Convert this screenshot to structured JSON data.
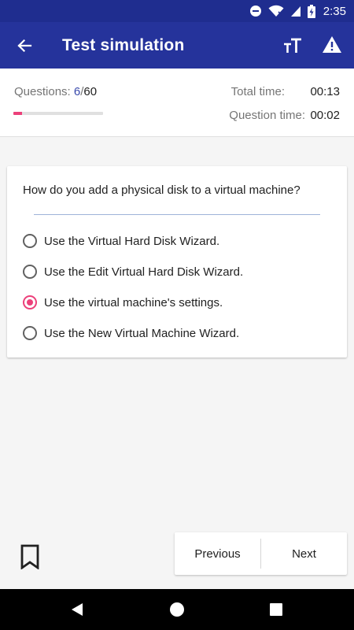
{
  "status_bar": {
    "time": "2:35",
    "icons": [
      "do-not-disturb-icon",
      "wifi-icon",
      "signal-icon",
      "battery-charging-icon"
    ]
  },
  "app_bar": {
    "title": "Test simulation",
    "icons": [
      "back-arrow-icon",
      "text-size-icon",
      "warning-icon"
    ]
  },
  "progress": {
    "questions_label": "Questions:",
    "current": "6",
    "separator": "/",
    "total": "60",
    "fraction": 0.1,
    "fill_color": "#ec407a",
    "total_time_label": "Total time:",
    "total_time": "00:13",
    "question_time_label": "Question time:",
    "question_time": "00:02"
  },
  "question": {
    "text": "How do you add a physical disk to a virtual machine?",
    "answers": [
      {
        "label": "Use the Virtual Hard Disk Wizard.",
        "selected": false
      },
      {
        "label": "Use the Edit Virtual Hard Disk Wizard.",
        "selected": false
      },
      {
        "label": "Use the virtual machine's settings.",
        "selected": true
      },
      {
        "label": "Use the New Virtual Machine Wizard.",
        "selected": false
      }
    ]
  },
  "footer": {
    "bookmark_icon": "bookmark-icon",
    "previous_label": "Previous",
    "next_label": "Next"
  },
  "system_nav": {
    "icons": [
      "back-triangle-icon",
      "home-circle-icon",
      "recents-square-icon"
    ]
  },
  "colors": {
    "app_bar": "#25339b",
    "status_bar": "#1f2d8f",
    "accent": "#ec407a",
    "current_question": "#3949ab"
  }
}
